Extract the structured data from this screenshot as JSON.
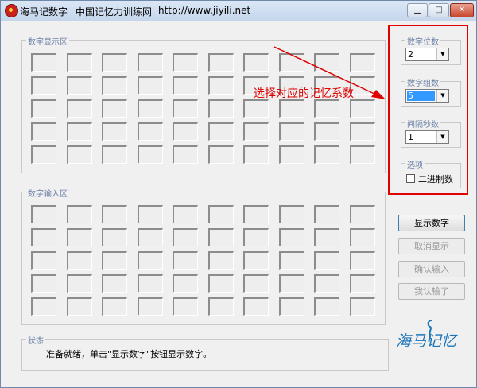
{
  "window": {
    "app_title": "海马记数字",
    "org_name": "中国记忆力训练网",
    "url": "http://www.jiyili.net",
    "controls": {
      "minimize": "▁",
      "maximize": "□",
      "close": "✕"
    }
  },
  "display_area": {
    "label": "数字显示区",
    "rows": 5,
    "cols": 10
  },
  "input_area": {
    "label": "数字输入区",
    "rows": 5,
    "cols": 10
  },
  "settings": {
    "digits_per_group": {
      "label": "数字位数",
      "value": "2"
    },
    "group_count": {
      "label": "数字组数",
      "value": "5"
    },
    "interval_seconds": {
      "label": "间隔秒数",
      "value": "1"
    },
    "options": {
      "label": "选项",
      "binary_label": "二进制数",
      "binary_checked": false
    }
  },
  "buttons": {
    "show_digits": "显示数字",
    "cancel_display": "取消显示",
    "confirm_input": "确认输入",
    "i_give_up": "我认输了"
  },
  "status": {
    "label": "状态",
    "text": "准备就绪，单击\"显示数字\"按钮显示数字。"
  },
  "annotation": {
    "text": "选择对应的记忆系数",
    "color": "#e00000"
  },
  "logo": {
    "text": "海马记忆",
    "color": "#1c75b8"
  },
  "colors": {
    "highlight": "#e00000",
    "accent": "#3399ff"
  }
}
